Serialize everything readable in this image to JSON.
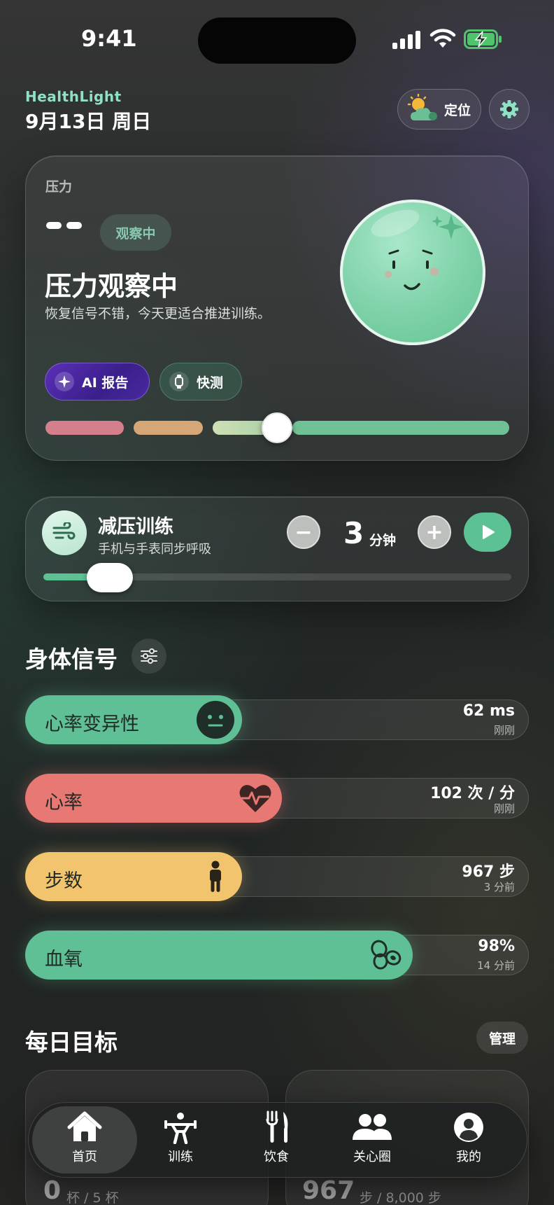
{
  "status_bar": {
    "time": "9:41"
  },
  "header": {
    "brand": "HealthLight",
    "date": "9月13日 周日",
    "location_label": "定位"
  },
  "stress_card": {
    "label": "压力",
    "value_placeholder": "--",
    "status_badge": "观察中",
    "title": "压力观察中",
    "subtitle": "恢复信号不错，今天更适合推进训练。",
    "ai_report_label": "AI 报告",
    "quick_test_label": "快测",
    "scale_position": 0.5
  },
  "relax_training": {
    "title": "减压训练",
    "subtitle": "手机与手表同步呼吸",
    "minus_label": "−",
    "plus_label": "+",
    "duration_value": "3",
    "duration_unit": "分钟",
    "progress": 0.1
  },
  "body_signals": {
    "title": "身体信号",
    "items": [
      {
        "label": "心率变异性",
        "value": "62 ms",
        "time": "刚刚",
        "color": "#5fbf95",
        "fill": 0.43,
        "icon": "neutral-face-icon"
      },
      {
        "label": "心率",
        "value": "102 次 / 分",
        "time": "刚刚",
        "color": "#e77873",
        "fill": 0.51,
        "icon": "heart-pulse-icon"
      },
      {
        "label": "步数",
        "value": "967 步",
        "time": "3 分前",
        "color": "#f2c46d",
        "fill": 0.43,
        "icon": "person-icon"
      },
      {
        "label": "血氧",
        "value": "98%",
        "time": "14 分前",
        "color": "#5fbf95",
        "fill": 0.77,
        "icon": "blood-cells-icon"
      }
    ]
  },
  "daily_goals": {
    "title": "每日目标",
    "manage_label": "管理",
    "water": {
      "value": "0",
      "unit": "杯 / 5 杯"
    },
    "steps": {
      "value": "967",
      "unit": "步 / 8,000 步"
    }
  },
  "tabbar": {
    "items": [
      {
        "label": "首页",
        "icon": "home-icon",
        "active": true
      },
      {
        "label": "训练",
        "icon": "weightlifting-icon",
        "active": false
      },
      {
        "label": "饮食",
        "icon": "fork-knife-icon",
        "active": false
      },
      {
        "label": "关心圈",
        "icon": "people-icon",
        "active": false
      },
      {
        "label": "我的",
        "icon": "profile-icon",
        "active": false
      }
    ]
  }
}
